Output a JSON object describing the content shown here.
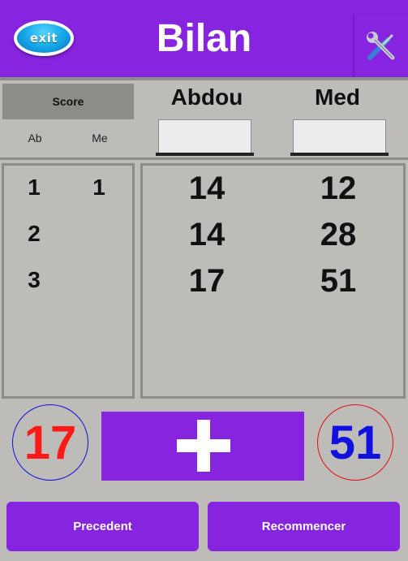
{
  "header": {
    "title": "Bilan",
    "exit_label": "exit",
    "settings_icon": "tools-icon",
    "color": "#8624e0"
  },
  "scoreboard": {
    "score_label": "Score",
    "abbr_1": "Ab",
    "abbr_2": "Me"
  },
  "players": [
    {
      "name": "Abdou",
      "input_value": ""
    },
    {
      "name": "Med",
      "input_value": ""
    }
  ],
  "rounds": {
    "numbers": [
      "1",
      "2",
      "3"
    ],
    "winner_abbr_col_1": [
      "1",
      "",
      ""
    ]
  },
  "scores": {
    "abdou": [
      "14",
      "14",
      "17"
    ],
    "med": [
      "12",
      "28",
      "51"
    ]
  },
  "totals": {
    "abdou": "17",
    "abdou_color": "#ff1a1a",
    "med": "51",
    "med_color": "#1010e0"
  },
  "buttons": {
    "add_icon": "plus-icon",
    "previous": "Precedent",
    "restart": "Recommencer"
  }
}
